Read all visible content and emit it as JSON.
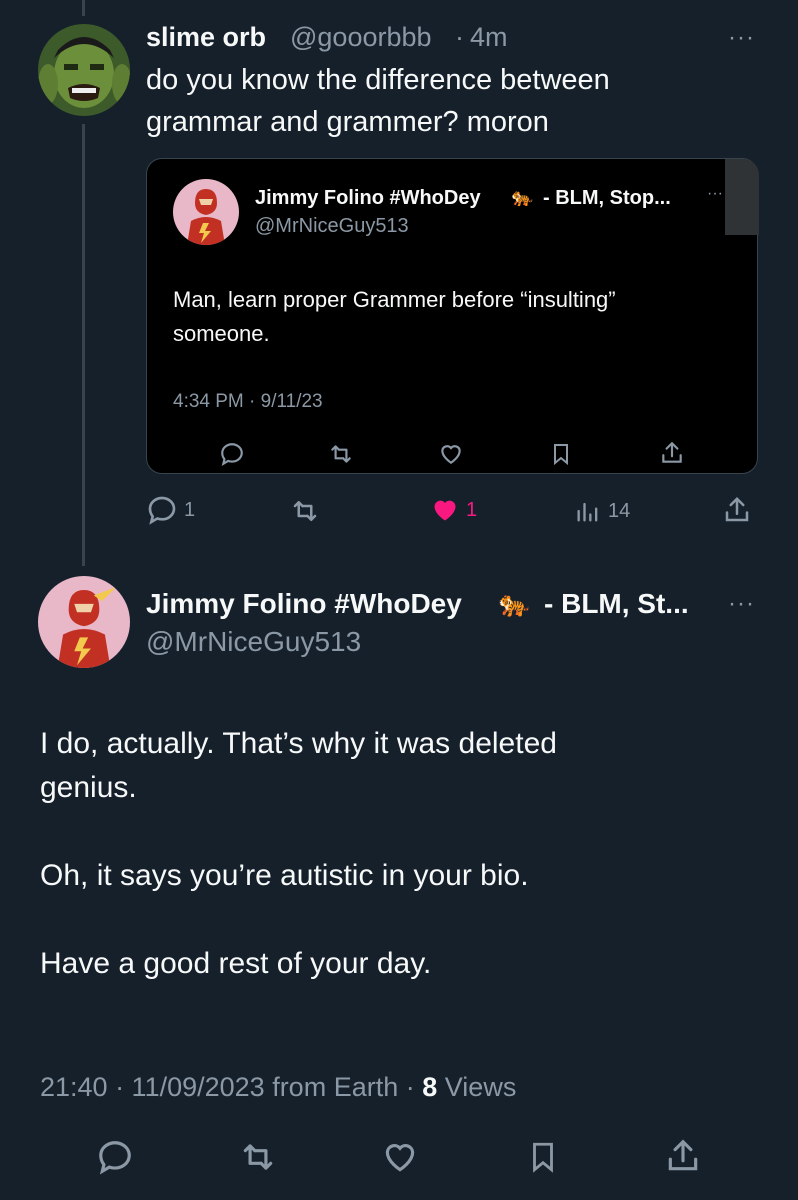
{
  "tweet1": {
    "display_name": "slime orb",
    "handle": "@gooorbbb",
    "time": "4m",
    "text_line1": "do you know the difference between",
    "text_line2": "grammar and grammer? moron",
    "avatar_icon": "hulk-avatar",
    "actions": {
      "reply_count": "1",
      "like_count": "1",
      "views_count": "14"
    }
  },
  "quote": {
    "display_name": "Jimmy Folino #WhoDey",
    "name_suffix": "- BLM, Stop...",
    "handle": "@MrNiceGuy513",
    "text_line1": "Man, learn proper Grammer before “insulting”",
    "text_line2": "someone.",
    "timestamp": "4:34 PM · 9/11/23",
    "avatar_icon": "flash-avatar"
  },
  "tweet2": {
    "display_name": "Jimmy Folino #WhoDey",
    "name_suffix": "- BLM, St...",
    "handle": "@MrNiceGuy513",
    "emoji": "🐅",
    "paragraph1_line1": "I do, actually. That’s why it was deleted",
    "paragraph1_line2": "genius.",
    "paragraph2": "Oh, it says you’re autistic in your bio.",
    "paragraph3": "Have a good rest of your day.",
    "meta_time": "21:40 · 11/09/2023 from Earth ·",
    "meta_views_count": "8",
    "meta_views_label": "Views"
  },
  "colors": {
    "background": "#15202b",
    "text": "#f7f9f9",
    "muted": "#8b98a5",
    "like_active": "#f91880",
    "thread_line": "#38444d"
  }
}
